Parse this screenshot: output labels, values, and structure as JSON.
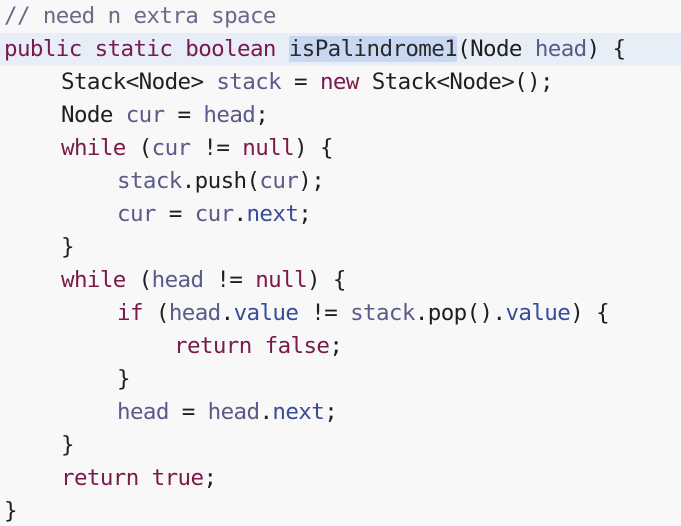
{
  "code": {
    "lines": [
      [
        {
          "t": "// need n extra space",
          "c": "comment"
        }
      ],
      [
        {
          "t": "public static boolean ",
          "c": "kw"
        },
        {
          "t": "isPalindrome1",
          "c": "ident sel"
        },
        {
          "t": "(Node ",
          "c": "punct"
        },
        {
          "t": "head",
          "c": "var"
        },
        {
          "t": ") {",
          "c": "punct"
        }
      ],
      [
        {
          "t": "Stack<Node> ",
          "c": "type"
        },
        {
          "t": "stack",
          "c": "var"
        },
        {
          "t": " = ",
          "c": "punct"
        },
        {
          "t": "new",
          "c": "kw"
        },
        {
          "t": " Stack<Node>();",
          "c": "type"
        }
      ],
      [
        {
          "t": "Node ",
          "c": "type"
        },
        {
          "t": "cur",
          "c": "var"
        },
        {
          "t": " = ",
          "c": "punct"
        },
        {
          "t": "head",
          "c": "var"
        },
        {
          "t": ";",
          "c": "punct"
        }
      ],
      [
        {
          "t": "while",
          "c": "kw"
        },
        {
          "t": " (",
          "c": "punct"
        },
        {
          "t": "cur",
          "c": "var"
        },
        {
          "t": " != ",
          "c": "punct"
        },
        {
          "t": "null",
          "c": "kw"
        },
        {
          "t": ") {",
          "c": "punct"
        }
      ],
      [
        {
          "t": "stack",
          "c": "var"
        },
        {
          "t": ".push(",
          "c": "punct"
        },
        {
          "t": "cur",
          "c": "var"
        },
        {
          "t": ");",
          "c": "punct"
        }
      ],
      [
        {
          "t": "cur",
          "c": "var"
        },
        {
          "t": " = ",
          "c": "punct"
        },
        {
          "t": "cur",
          "c": "var"
        },
        {
          "t": ".",
          "c": "punct"
        },
        {
          "t": "next",
          "c": "field"
        },
        {
          "t": ";",
          "c": "punct"
        }
      ],
      [
        {
          "t": "}",
          "c": "punct"
        }
      ],
      [
        {
          "t": "while",
          "c": "kw"
        },
        {
          "t": " (",
          "c": "punct"
        },
        {
          "t": "head",
          "c": "var"
        },
        {
          "t": " != ",
          "c": "punct"
        },
        {
          "t": "null",
          "c": "kw"
        },
        {
          "t": ") {",
          "c": "punct"
        }
      ],
      [
        {
          "t": "if",
          "c": "kw"
        },
        {
          "t": " (",
          "c": "punct"
        },
        {
          "t": "head",
          "c": "var"
        },
        {
          "t": ".",
          "c": "punct"
        },
        {
          "t": "value",
          "c": "field"
        },
        {
          "t": " != ",
          "c": "punct"
        },
        {
          "t": "stack",
          "c": "var"
        },
        {
          "t": ".pop().",
          "c": "punct"
        },
        {
          "t": "value",
          "c": "field"
        },
        {
          "t": ") {",
          "c": "punct"
        }
      ],
      [
        {
          "t": "return",
          "c": "kw"
        },
        {
          "t": " ",
          "c": "punct"
        },
        {
          "t": "false",
          "c": "kw"
        },
        {
          "t": ";",
          "c": "punct"
        }
      ],
      [
        {
          "t": "}",
          "c": "punct"
        }
      ],
      [
        {
          "t": "head",
          "c": "var"
        },
        {
          "t": " = ",
          "c": "punct"
        },
        {
          "t": "head",
          "c": "var"
        },
        {
          "t": ".",
          "c": "punct"
        },
        {
          "t": "next",
          "c": "field"
        },
        {
          "t": ";",
          "c": "punct"
        }
      ],
      [
        {
          "t": "}",
          "c": "punct"
        }
      ],
      [
        {
          "t": "return",
          "c": "kw"
        },
        {
          "t": " ",
          "c": "punct"
        },
        {
          "t": "true",
          "c": "kw"
        },
        {
          "t": ";",
          "c": "punct"
        }
      ],
      [
        {
          "t": "}",
          "c": "punct"
        }
      ]
    ]
  },
  "colors": {
    "background": "#f8f8f8",
    "current_line": "#e8eef7",
    "selection": "#c9d8f2",
    "keyword": "#7a1a4a",
    "comment": "#6a6a8a",
    "variable": "#5b5b8a",
    "field": "#3a4a9a"
  }
}
